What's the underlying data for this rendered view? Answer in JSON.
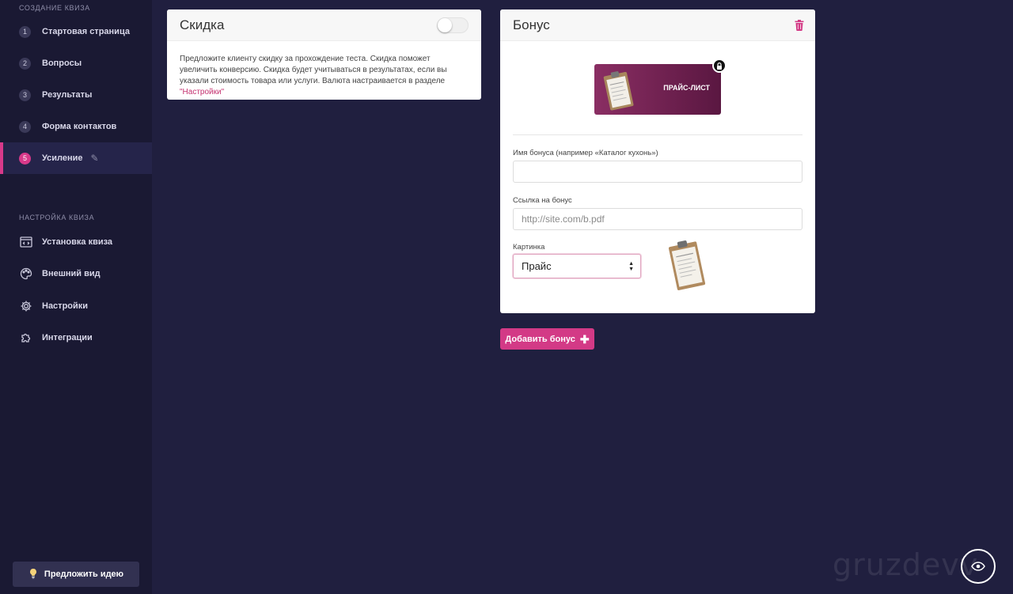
{
  "sidebar": {
    "section_create": "СОЗДАНИЕ КВИЗА",
    "steps": [
      {
        "num": "1",
        "label": "Стартовая страница"
      },
      {
        "num": "2",
        "label": "Вопросы"
      },
      {
        "num": "3",
        "label": "Результаты"
      },
      {
        "num": "4",
        "label": "Форма контактов"
      },
      {
        "num": "5",
        "label": "Усиление",
        "active": true
      }
    ],
    "section_settings": "НАСТРОЙКА КВИЗА",
    "settings_items": [
      {
        "label": "Установка квиза",
        "icon": "code-window-icon"
      },
      {
        "label": "Внешний вид",
        "icon": "palette-icon"
      },
      {
        "label": "Настройки",
        "icon": "gear-icon"
      },
      {
        "label": "Интеграции",
        "icon": "puzzle-icon"
      }
    ],
    "idea_button": "Предложить идею"
  },
  "discount": {
    "title": "Скидка",
    "toggle_on": false,
    "description": "Предложите клиенту скидку за прохождение теста. Скидка поможет увеличить конверсию. Скидка будет учитываться в результатах, если вы указали стоимость товара или услуги. Валюта настраивается в разделе ",
    "settings_link": "\"Настройки\""
  },
  "bonus": {
    "title": "Бонус",
    "banner_text": "ПРАЙС-ЛИСТ",
    "name_label": "Имя бонуса (например «Каталог кухонь»)",
    "name_value": "",
    "link_label": "Ссылка на бонус",
    "link_placeholder": "http://site.com/b.pdf",
    "image_label": "Картинка",
    "image_selected": "Прайс"
  },
  "add_bonus_button": "Добавить бонус",
  "watermark": "gruzdevv",
  "colors": {
    "background": "#201f3f",
    "sidebar": "#1a1933",
    "accent": "#d33a86"
  }
}
